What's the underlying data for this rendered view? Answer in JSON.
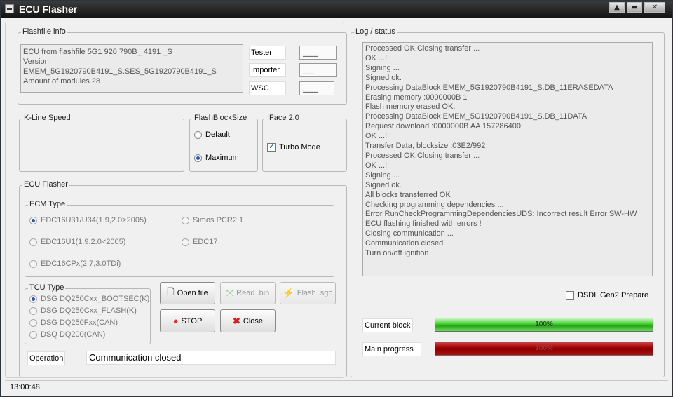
{
  "window": {
    "title": "ECU Flasher",
    "min": "▲",
    "max": "▬",
    "close": "✕"
  },
  "flashfile": {
    "legend": "Flashfile info",
    "info_lines": [
      "ECU from flashfile 5G1 920 790B_ 4191 _S",
      "Version EMEM_5G1920790B4191_S.SES_5G1920790B4191_S",
      "Amount of modules 28"
    ],
    "tester_label": "Tester",
    "tester_value": "____",
    "importer_label": "Importer",
    "importer_value": "___",
    "wsc_label": "WSC",
    "wsc_value": "____"
  },
  "kline": {
    "legend": "K-Line Speed"
  },
  "flashblock": {
    "legend": "FlashBlockSize",
    "default_label": "Default",
    "maximum_label": "Maximum",
    "selected": "Maximum"
  },
  "iface": {
    "legend": "IFace 2.0",
    "turbo_label": "Turbo Mode",
    "turbo_checked": true
  },
  "ecu_flasher": {
    "legend": "ECU Flasher",
    "ecm_legend": "ECM Type",
    "ecm_options": [
      "EDC16U31/U34(1.9,2.0>2005)",
      "EDC16U1(1.9,2.0<2005)",
      "EDC16CPx(2.7,3.0TDi)",
      "Simos PCR2.1",
      "EDC17"
    ],
    "ecm_selected": "EDC16U31/U34(1.9,2.0>2005)",
    "tcu_legend": "TCU Type",
    "tcu_options": [
      "DSG DQ250Cxx_BOOTSEC(K)",
      "DSG DQ250Cxx_FLASH(K)",
      "DSG DQ250Fxx(CAN)",
      "DSQ DQ200(CAN)"
    ],
    "tcu_selected": "DSG DQ250Cxx_BOOTSEC(K)",
    "buttons": {
      "open_file": "Open file",
      "read_bin": "Read .bin",
      "flash_sgo": "Flash .sgo",
      "stop": "STOP",
      "close": "Close"
    },
    "operation_label": "Operation",
    "operation_value": "Communication closed"
  },
  "log": {
    "legend": "Log / status",
    "lines": [
      "Processed OK,Closing transfer ...",
      "OK ...!",
      "Signing ...",
      "Signed ok.",
      "Processing DataBlock EMEM_5G1920790B4191_S.DB_11ERASEDATA",
      "Erasing memory :0000000B 1",
      "Flash memory erased OK.",
      "Processing DataBlock EMEM_5G1920790B4191_S.DB_11DATA",
      "Request download :0000000B AA 157286400",
      "OK ...!",
      "Transfer Data, blocksize :03E2/992",
      "Processed OK,Closing transfer ...",
      "OK ...!",
      "Signing ...",
      "Signed ok.",
      "All blocks transferred OK",
      "Checking programming dependencies ...",
      "Error RunCheckProgrammingDependenciesUDS: Incorrect result Error SW-HW",
      "ECU flashing finished with errors !",
      "Closing communication ...",
      "Communication closed",
      "Turn on/off ignition"
    ],
    "dsdl_label": "DSDL Gen2 Prepare",
    "dsdl_checked": false
  },
  "progress": {
    "current_label": "Current block",
    "current_value": 100,
    "current_text": "100%",
    "main_label": "Main progress",
    "main_value": 100,
    "main_text": "100%"
  },
  "status": {
    "time": "13:00:48"
  },
  "colors": {
    "progress_green": "#2fbf1e",
    "progress_red": "#a00000",
    "radio_selected": "#2a55b0"
  }
}
